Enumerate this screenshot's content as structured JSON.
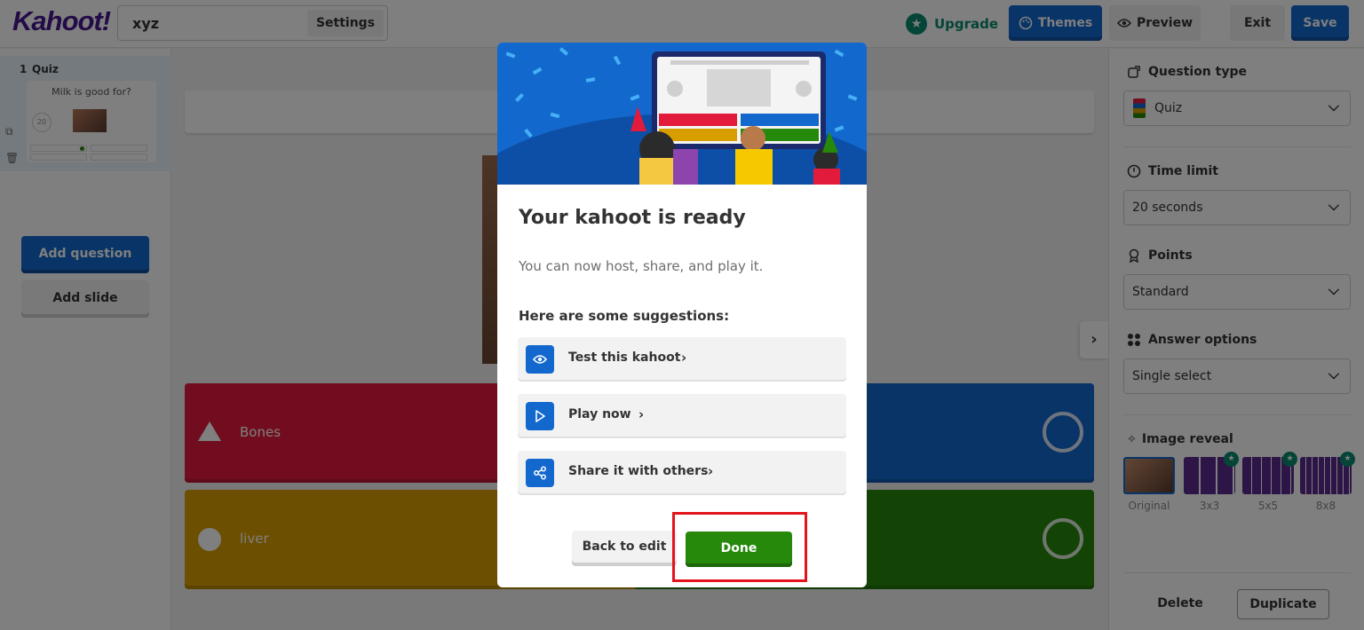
{
  "app": {
    "logo": "Kahoot!",
    "title_value": "xyz",
    "settings_label": "Settings",
    "upgrade_label": "Upgrade",
    "themes_label": "Themes",
    "preview_label": "Preview",
    "exit_label": "Exit",
    "save_label": "Save"
  },
  "sidebar": {
    "slides": [
      {
        "number": "1",
        "type": "Quiz",
        "question": "Milk is good for?",
        "timer": "20"
      }
    ],
    "add_question_label": "Add question",
    "add_slide_label": "Add slide"
  },
  "answers": [
    {
      "text": "Bones",
      "color": "#e21b3c",
      "shape": "triangle"
    },
    {
      "text": "",
      "color": "#1368ce",
      "shape": "diamond"
    },
    {
      "text": "liver",
      "color": "#d89e00",
      "shape": "circle"
    },
    {
      "text": "",
      "color": "#26890c",
      "shape": "square"
    }
  ],
  "settings_panel": {
    "question_type": {
      "label": "Question type",
      "value": "Quiz"
    },
    "time_limit": {
      "label": "Time limit",
      "value": "20 seconds"
    },
    "points": {
      "label": "Points",
      "value": "Standard"
    },
    "answer_options": {
      "label": "Answer options",
      "value": "Single select"
    },
    "image_reveal": {
      "label": "Image reveal",
      "options": [
        {
          "label": "Original",
          "premium": false,
          "selected": true
        },
        {
          "label": "3x3",
          "premium": true,
          "selected": false
        },
        {
          "label": "5x5",
          "premium": true,
          "selected": false
        },
        {
          "label": "8x8",
          "premium": true,
          "selected": false
        }
      ]
    },
    "delete_label": "Delete",
    "duplicate_label": "Duplicate"
  },
  "modal": {
    "title": "Your kahoot is ready",
    "subtitle": "You can now host, share, and play it.",
    "suggestions_heading": "Here are some suggestions:",
    "suggestions": [
      {
        "label": "Test this kahoot",
        "icon": "eye-icon"
      },
      {
        "label": "Play now",
        "icon": "play-icon"
      },
      {
        "label": "Share it with others",
        "icon": "share-icon"
      }
    ],
    "back_label": "Back to edit",
    "done_label": "Done"
  },
  "colors": {
    "brand_purple": "#46178f",
    "primary_blue": "#1368ce",
    "success_green": "#26890c",
    "premium_teal": "#0b8a6e",
    "highlight_red": "#e3141c"
  }
}
